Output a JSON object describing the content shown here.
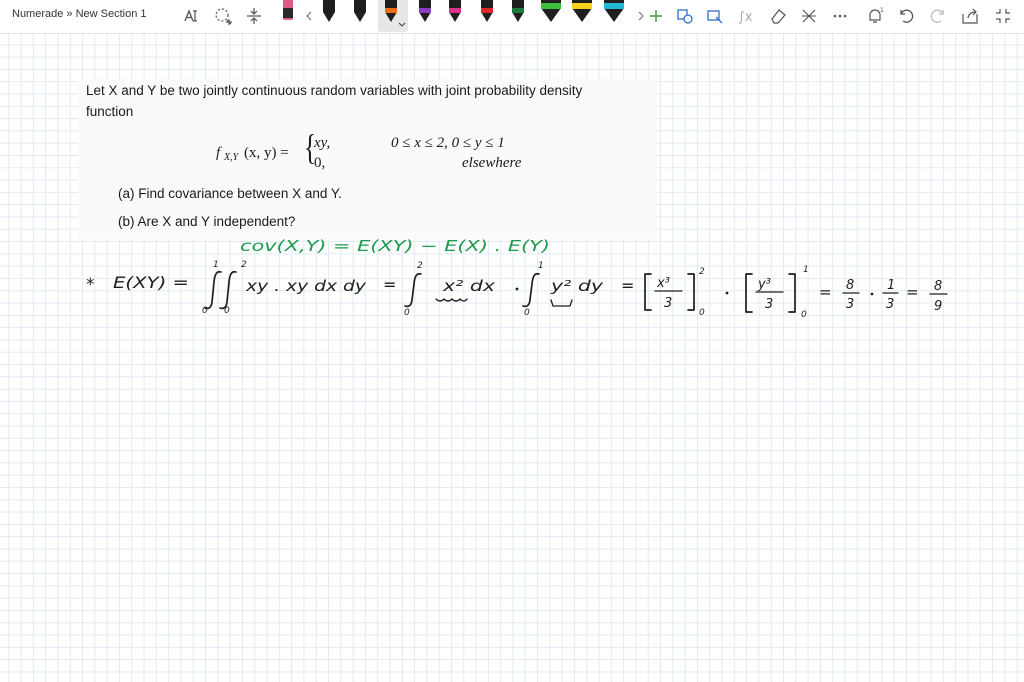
{
  "app": {
    "breadcrumb": "Numerade » New Section 1"
  },
  "toolbar": {
    "pens": [
      {
        "name": "pen-pink",
        "color": "#e05a8a"
      },
      {
        "name": "pen-black-1",
        "color": "#1f1f1f"
      },
      {
        "name": "pen-black-2",
        "color": "#1f1f1f"
      },
      {
        "name": "pen-black-3",
        "color": "#1f1f1f"
      },
      {
        "name": "pen-orange-selected",
        "color": "#ef6c1a"
      },
      {
        "name": "pen-purple",
        "color": "#8a3fc0"
      },
      {
        "name": "pen-magenta",
        "color": "#d9338a"
      },
      {
        "name": "pen-red",
        "color": "#e02a2a"
      },
      {
        "name": "pen-dark-green",
        "color": "#1d7a3a"
      },
      {
        "name": "pen-green",
        "color": "#3cbf3c"
      },
      {
        "name": "pen-yellow",
        "color": "#f3d21b"
      },
      {
        "name": "pen-cyan",
        "color": "#23b6d6"
      },
      {
        "name": "pen-blue",
        "color": "#3a77d8"
      }
    ],
    "accent_color": "#1c9b4b"
  },
  "problem": {
    "intro_line1": "Let X and Y be two jointly continuous random variables with joint probability density",
    "intro_line2": "function",
    "pdf_lhs_f": "f",
    "pdf_lhs_sub": "X,Y",
    "pdf_lhs_args": "(x, y) =",
    "case1_value": "xy,",
    "case1_condition": "0 ≤ x ≤ 2, 0 ≤ y ≤ 1",
    "case2_value": "0,",
    "case2_condition": "elsewhere",
    "part_a": "(a) Find covariance between X and Y.",
    "part_b": "(b) Are X and Y independent?"
  },
  "handwriting": {
    "cov_line": "cov(X,Y) = E(XY) − E(X) . E(Y)",
    "bullet": "*",
    "exy": "E(XY) =",
    "integrand": "xy . xy dx dy",
    "eq": "=",
    "x2dx": "x² dx",
    "y2dy": "y² dy",
    "x3over3_num": "x³",
    "x3over3_den": "3",
    "y3over3_num": "y³",
    "y3over3_den": "3",
    "lim_upper_2": "2",
    "lim_upper_1": "1",
    "lim_lower_0": "0",
    "frac1_num": "8",
    "frac1_den": "3",
    "frac2_num": "1",
    "frac2_den": "3",
    "result_num": "8",
    "result_den": "9"
  }
}
